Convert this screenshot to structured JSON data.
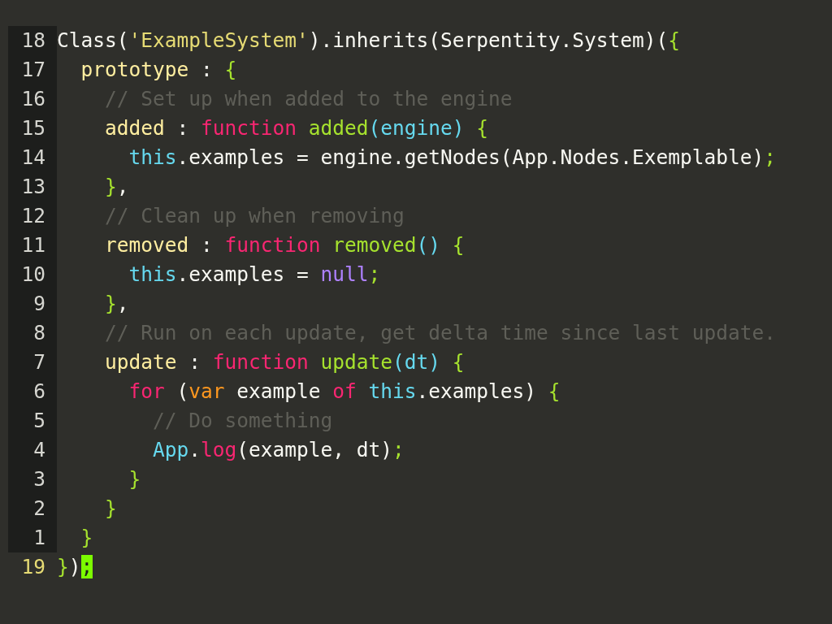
{
  "editor": {
    "lines": [
      {
        "number": "18",
        "current": false,
        "tokens": [
          {
            "kind": "plain",
            "text": "Class("
          },
          {
            "kind": "string",
            "text": "'ExampleSystem'"
          },
          {
            "kind": "plain",
            "text": ").inherits(Serpentity.System)("
          },
          {
            "kind": "punct",
            "text": "{"
          }
        ]
      },
      {
        "number": "17",
        "current": false,
        "tokens": [
          {
            "kind": "key",
            "text": "  prototype"
          },
          {
            "kind": "plain",
            "text": " : "
          },
          {
            "kind": "punct",
            "text": "{"
          }
        ]
      },
      {
        "number": "16",
        "current": false,
        "tokens": [
          {
            "kind": "comment",
            "text": "    // Set up when added to the engine"
          }
        ]
      },
      {
        "number": "15",
        "current": false,
        "tokens": [
          {
            "kind": "key",
            "text": "    added"
          },
          {
            "kind": "plain",
            "text": " : "
          },
          {
            "kind": "keyword",
            "text": "function "
          },
          {
            "kind": "funcname",
            "text": "added"
          },
          {
            "kind": "param",
            "text": "(engine)"
          },
          {
            "kind": "punct",
            "text": " {"
          }
        ]
      },
      {
        "number": "14",
        "current": false,
        "tokens": [
          {
            "kind": "builtin",
            "text": "      this"
          },
          {
            "kind": "plain",
            "text": ".examples = engine.getNodes(App.Nodes.Exemplable)"
          },
          {
            "kind": "punct",
            "text": ";"
          }
        ]
      },
      {
        "number": "13",
        "current": false,
        "tokens": [
          {
            "kind": "punct",
            "text": "    }"
          },
          {
            "kind": "plain",
            "text": ","
          }
        ]
      },
      {
        "number": "12",
        "current": false,
        "tokens": [
          {
            "kind": "comment",
            "text": "    // Clean up when removing"
          }
        ]
      },
      {
        "number": "11",
        "current": false,
        "tokens": [
          {
            "kind": "key",
            "text": "    removed"
          },
          {
            "kind": "plain",
            "text": " : "
          },
          {
            "kind": "keyword",
            "text": "function "
          },
          {
            "kind": "funcname",
            "text": "removed"
          },
          {
            "kind": "param",
            "text": "()"
          },
          {
            "kind": "punct",
            "text": " {"
          }
        ]
      },
      {
        "number": "10",
        "current": false,
        "tokens": [
          {
            "kind": "builtin",
            "text": "      this"
          },
          {
            "kind": "plain",
            "text": ".examples = "
          },
          {
            "kind": "constant",
            "text": "null"
          },
          {
            "kind": "punct",
            "text": ";"
          }
        ]
      },
      {
        "number": "9",
        "current": false,
        "tokens": [
          {
            "kind": "punct",
            "text": "    }"
          },
          {
            "kind": "plain",
            "text": ","
          }
        ]
      },
      {
        "number": "8",
        "current": false,
        "tokens": [
          {
            "kind": "comment",
            "text": "    // Run on each update, get delta time since last update."
          }
        ]
      },
      {
        "number": "7",
        "current": false,
        "tokens": [
          {
            "kind": "key",
            "text": "    update"
          },
          {
            "kind": "plain",
            "text": " : "
          },
          {
            "kind": "keyword",
            "text": "function "
          },
          {
            "kind": "funcname",
            "text": "update"
          },
          {
            "kind": "param",
            "text": "(dt)"
          },
          {
            "kind": "punct",
            "text": " {"
          }
        ]
      },
      {
        "number": "6",
        "current": false,
        "tokens": [
          {
            "kind": "keyword",
            "text": "      for"
          },
          {
            "kind": "plain",
            "text": " ("
          },
          {
            "kind": "storage",
            "text": "var"
          },
          {
            "kind": "plain",
            "text": " example "
          },
          {
            "kind": "keyword",
            "text": "of "
          },
          {
            "kind": "builtin",
            "text": "this"
          },
          {
            "kind": "plain",
            "text": ".examples) "
          },
          {
            "kind": "punct",
            "text": "{"
          }
        ]
      },
      {
        "number": "5",
        "current": false,
        "tokens": [
          {
            "kind": "comment",
            "text": "        // Do something"
          }
        ]
      },
      {
        "number": "4",
        "current": false,
        "tokens": [
          {
            "kind": "builtin",
            "text": "        App"
          },
          {
            "kind": "plain",
            "text": "."
          },
          {
            "kind": "keyword",
            "text": "log"
          },
          {
            "kind": "plain",
            "text": "(example, dt)"
          },
          {
            "kind": "punct",
            "text": ";"
          }
        ]
      },
      {
        "number": "3",
        "current": false,
        "tokens": [
          {
            "kind": "punct",
            "text": "      }"
          }
        ]
      },
      {
        "number": "2",
        "current": false,
        "tokens": [
          {
            "kind": "punct",
            "text": "    }"
          }
        ]
      },
      {
        "number": "1",
        "current": false,
        "tokens": [
          {
            "kind": "punct",
            "text": "  }"
          }
        ]
      },
      {
        "number": "19",
        "current": true,
        "tokens": [
          {
            "kind": "punct",
            "text": "}"
          },
          {
            "kind": "plain",
            "text": ")"
          },
          {
            "kind": "cursor",
            "text": ";"
          }
        ]
      }
    ]
  }
}
